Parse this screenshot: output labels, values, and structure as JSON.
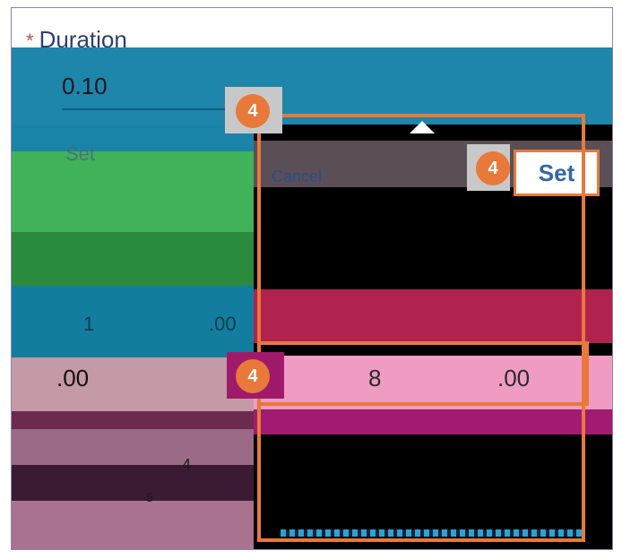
{
  "duration": {
    "required_marker": "*",
    "label": "Duration",
    "value": "0.10"
  },
  "picker": {
    "partial_label": "Set",
    "cancel_label": "Cancel",
    "set_label": "Set",
    "left_column": {
      "row1_a": "1",
      "row1_b": ".00",
      "selected": ".00",
      "below_1": "4",
      "below_2": "5"
    },
    "selected_row": {
      "hour": "8",
      "minute": ".00"
    }
  },
  "annotations": {
    "step_number": "4",
    "color": "#e8793a"
  }
}
